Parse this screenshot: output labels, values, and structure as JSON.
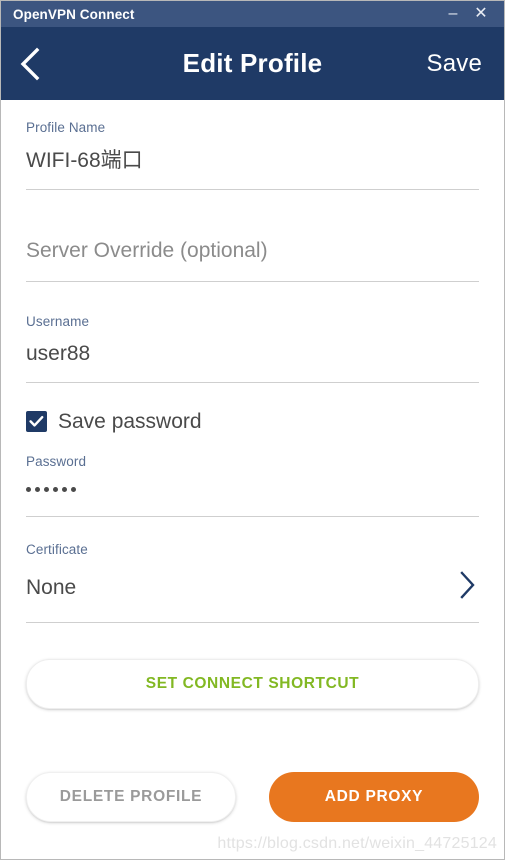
{
  "titlebar": {
    "app_title": "OpenVPN Connect",
    "minimize_glyph": "–",
    "close_glyph": "✕"
  },
  "appbar": {
    "back_icon": "chevron-left-icon",
    "title": "Edit Profile",
    "save_label": "Save"
  },
  "form": {
    "profile_name": {
      "label": "Profile Name",
      "value": "WIFI-68端口"
    },
    "server_override": {
      "placeholder": "Server Override (optional)",
      "value": ""
    },
    "username": {
      "label": "Username",
      "value": "user88"
    },
    "save_password": {
      "label": "Save password",
      "checked": true
    },
    "password": {
      "label": "Password",
      "masked_value": "••••••",
      "dot_count": 6
    },
    "certificate": {
      "label": "Certificate",
      "value": "None",
      "chevron_icon": "chevron-right-icon"
    }
  },
  "actions": {
    "set_connect_shortcut": "SET CONNECT SHORTCUT",
    "delete_profile": "DELETE PROFILE",
    "add_proxy": "ADD PROXY"
  },
  "watermark": {
    "text": "https://blog.csdn.net/weixin_44725124"
  },
  "colors": {
    "titlebar_bg": "#3c5580",
    "appbar_bg": "#1f3a66",
    "label_blue": "#5a6f92",
    "accent_green": "#82b823",
    "accent_orange": "#e8771f",
    "checkbox_fill": "#1f3a66",
    "underline": "#cfcfcf"
  }
}
